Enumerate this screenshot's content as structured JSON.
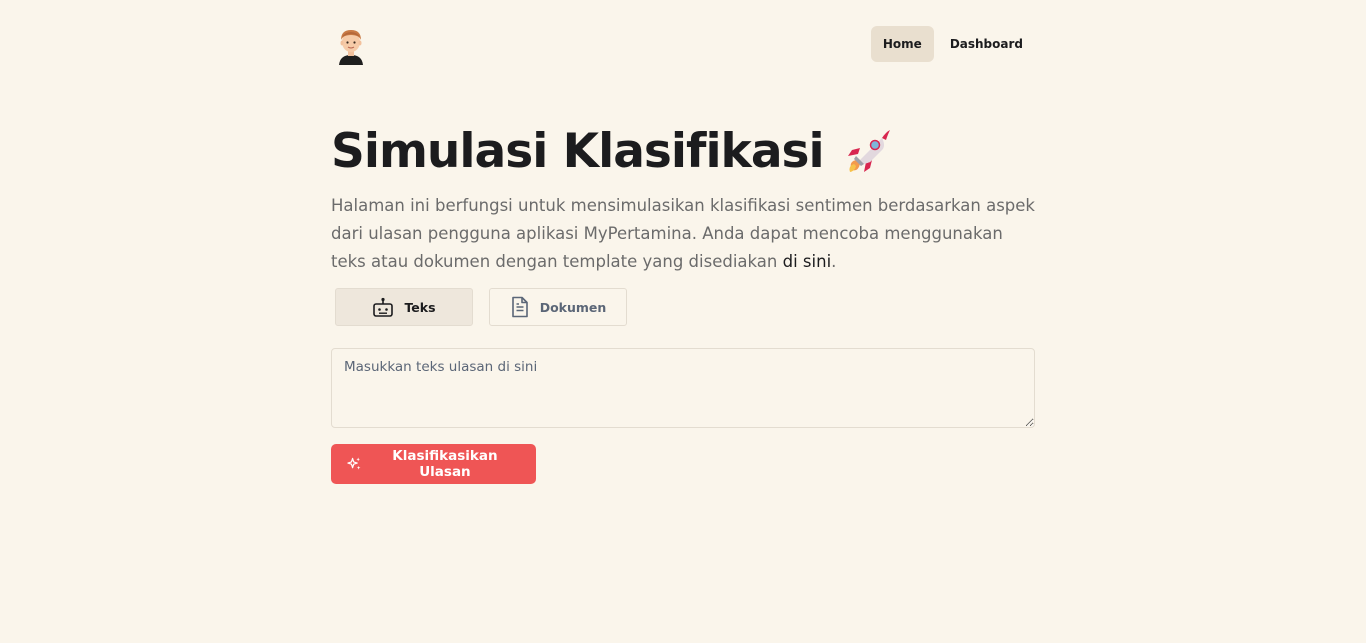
{
  "header": {
    "avatar_icon": "memoji-avatar",
    "nav": {
      "home_label": "Home",
      "dashboard_label": "Dashboard"
    }
  },
  "main": {
    "title": "Simulasi Klasifikasi",
    "title_icon": "rocket-emoji",
    "description_before_link": "Halaman ini berfungsi untuk mensimulasikan klasifikasi sentimen berdasarkan aspek dari ulasan pengguna aplikasi MyPertamina. Anda dapat mencoba menggunakan teks atau dokumen dengan template yang disediakan ",
    "description_link": "di sini",
    "description_after_link": ".",
    "tabs": [
      {
        "label": "Teks",
        "icon": "robot-icon",
        "active": true
      },
      {
        "label": "Dokumen",
        "icon": "document-icon",
        "active": false
      }
    ],
    "review_input": {
      "placeholder": "Masukkan teks ulasan di sini",
      "value": ""
    },
    "submit_label": "Klasifikasikan Ulasan",
    "submit_icon": "sparkles-icon"
  },
  "colors": {
    "background": "#faf5eb",
    "accent": "#ef5555",
    "nav_active": "#e9dfcf",
    "text": "#1c1c1e",
    "muted": "#6b6b6b"
  }
}
